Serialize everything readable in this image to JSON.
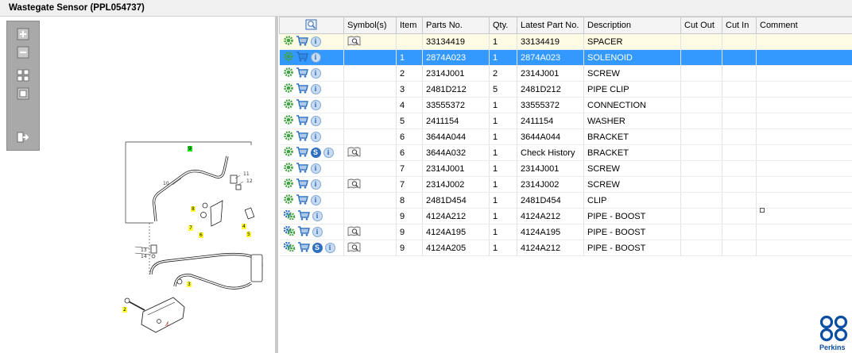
{
  "window": {
    "title": "Wastegate Sensor (PPL054737)"
  },
  "toolbar": {
    "buttons": [
      {
        "icon": "zoom-in-icon"
      },
      {
        "icon": "zoom-out-icon"
      },
      {
        "icon": "fit-all-icon"
      },
      {
        "icon": "fit-window-icon"
      },
      {
        "icon": "export-icon"
      }
    ]
  },
  "diagram": {
    "callouts": [
      "9",
      "10",
      "11",
      "12",
      "8",
      "7",
      "6",
      "4",
      "5",
      "13",
      "14",
      "3",
      "2",
      "1"
    ]
  },
  "table": {
    "columns": [
      "",
      "Symbol(s)",
      "Item",
      "Parts No.",
      "Qty.",
      "Latest Part No.",
      "Description",
      "Cut Out",
      "Cut In",
      "Comment"
    ],
    "rows": [
      {
        "icons": [
          "gear",
          "cart",
          "info"
        ],
        "symbol": "book",
        "item": "",
        "part_no": "33134419",
        "qty": "1",
        "latest": "33134419",
        "desc": "SPACER",
        "cut_out": "",
        "cut_in": "",
        "comment": ""
      },
      {
        "icons": [
          "gear",
          "cart",
          "info"
        ],
        "symbol": "",
        "item": "1",
        "part_no": "2874A023",
        "qty": "1",
        "latest": "2874A023",
        "desc": "SOLENOID",
        "cut_out": "",
        "cut_in": "",
        "comment": ""
      },
      {
        "icons": [
          "gear",
          "cart",
          "info"
        ],
        "symbol": "",
        "item": "2",
        "part_no": "2314J001",
        "qty": "2",
        "latest": "2314J001",
        "desc": "SCREW",
        "cut_out": "",
        "cut_in": "",
        "comment": ""
      },
      {
        "icons": [
          "gear",
          "cart",
          "info"
        ],
        "symbol": "",
        "item": "3",
        "part_no": "2481D212",
        "qty": "5",
        "latest": "2481D212",
        "desc": "PIPE CLIP",
        "cut_out": "",
        "cut_in": "",
        "comment": ""
      },
      {
        "icons": [
          "gear",
          "cart",
          "info"
        ],
        "symbol": "",
        "item": "4",
        "part_no": "33555372",
        "qty": "1",
        "latest": "33555372",
        "desc": "CONNECTION",
        "cut_out": "",
        "cut_in": "",
        "comment": ""
      },
      {
        "icons": [
          "gear",
          "cart",
          "info"
        ],
        "symbol": "",
        "item": "5",
        "part_no": "2411154",
        "qty": "1",
        "latest": "2411154",
        "desc": "WASHER",
        "cut_out": "",
        "cut_in": "",
        "comment": ""
      },
      {
        "icons": [
          "gear",
          "cart",
          "info"
        ],
        "symbol": "",
        "item": "6",
        "part_no": "3644A044",
        "qty": "1",
        "latest": "3644A044",
        "desc": "BRACKET",
        "cut_out": "",
        "cut_in": "",
        "comment": ""
      },
      {
        "icons": [
          "gear",
          "cart",
          "s",
          "info"
        ],
        "symbol": "book",
        "item": "6",
        "part_no": "3644A032",
        "qty": "1",
        "latest": "Check History",
        "desc": "BRACKET",
        "cut_out": "",
        "cut_in": "",
        "comment": ""
      },
      {
        "icons": [
          "gear",
          "cart",
          "info"
        ],
        "symbol": "",
        "item": "7",
        "part_no": "2314J001",
        "qty": "1",
        "latest": "2314J001",
        "desc": "SCREW",
        "cut_out": "",
        "cut_in": "",
        "comment": ""
      },
      {
        "icons": [
          "gear",
          "cart",
          "info"
        ],
        "symbol": "book",
        "item": "7",
        "part_no": "2314J002",
        "qty": "1",
        "latest": "2314J002",
        "desc": "SCREW",
        "cut_out": "",
        "cut_in": "",
        "comment": ""
      },
      {
        "icons": [
          "gear",
          "cart",
          "info"
        ],
        "symbol": "",
        "item": "8",
        "part_no": "2481D454",
        "qty": "1",
        "latest": "2481D454",
        "desc": "CLIP",
        "cut_out": "",
        "cut_in": "",
        "comment": ""
      },
      {
        "icons": [
          "gears",
          "cart",
          "info"
        ],
        "symbol": "",
        "item": "9",
        "part_no": "4124A212",
        "qty": "1",
        "latest": "4124A212",
        "desc": "PIPE - BOOST",
        "cut_out": "",
        "cut_in": "",
        "comment": ""
      },
      {
        "icons": [
          "gears",
          "cart",
          "info"
        ],
        "symbol": "book",
        "item": "9",
        "part_no": "4124A195",
        "qty": "1",
        "latest": "4124A195",
        "desc": "PIPE - BOOST",
        "cut_out": "",
        "cut_in": "",
        "comment": ""
      },
      {
        "icons": [
          "gears",
          "cart",
          "s",
          "info"
        ],
        "symbol": "book",
        "item": "9",
        "part_no": "4124A205",
        "qty": "1",
        "latest": "4124A212",
        "desc": "PIPE - BOOST",
        "cut_out": "",
        "cut_in": "",
        "comment": ""
      }
    ]
  },
  "brand": {
    "name": "Perkins",
    "color": "#0a4ea2"
  },
  "colors": {
    "selected_row": "#3399ff",
    "highlight_row": "#fdfbe3",
    "icon_green": "#3fa33f",
    "icon_blue": "#2a6fc4"
  }
}
